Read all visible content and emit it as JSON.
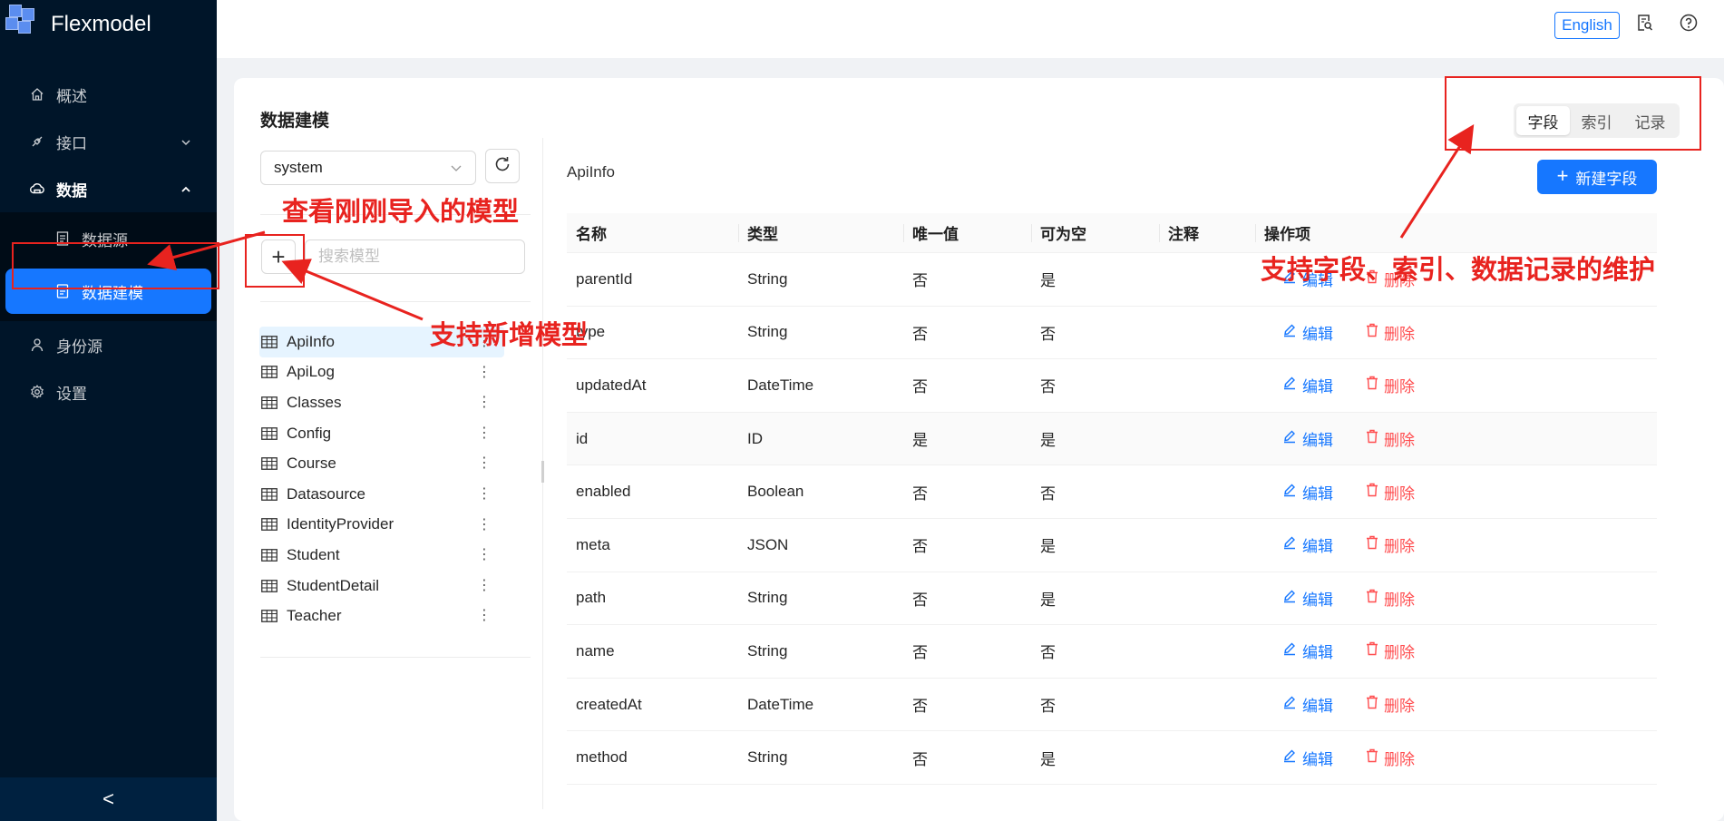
{
  "app": {
    "title": "Flexmodel"
  },
  "sidebar": {
    "items": [
      {
        "label": "概述",
        "icon": "home-icon"
      },
      {
        "label": "接口",
        "icon": "api-icon"
      },
      {
        "label": "数据",
        "icon": "cloud-icon"
      },
      {
        "label": "数据源",
        "icon": "file-icon"
      },
      {
        "label": "数据建模",
        "icon": "doc-icon"
      },
      {
        "label": "身份源",
        "icon": "user-icon"
      },
      {
        "label": "设置",
        "icon": "gear-icon"
      }
    ],
    "collapse": "<"
  },
  "header": {
    "lang": "English"
  },
  "page": {
    "title": "数据建模",
    "datasource": "system",
    "search_placeholder": "搜索模型",
    "models": [
      "ApiInfo",
      "ApiLog",
      "Classes",
      "Config",
      "Course",
      "Datasource",
      "IdentityProvider",
      "Student",
      "StudentDetail",
      "Teacher"
    ],
    "selected_model": "ApiInfo"
  },
  "right": {
    "tabs": [
      "字段",
      "索引",
      "记录"
    ],
    "active_tab": "字段",
    "model_name": "ApiInfo",
    "new_button": "新建字段",
    "columns": [
      "名称",
      "类型",
      "唯一值",
      "可为空",
      "注释",
      "操作项"
    ],
    "rows": [
      {
        "name": "parentId",
        "type": "String",
        "unique": "否",
        "nullable": "是",
        "comment": ""
      },
      {
        "name": "type",
        "type": "String",
        "unique": "否",
        "nullable": "否",
        "comment": ""
      },
      {
        "name": "updatedAt",
        "type": "DateTime",
        "unique": "否",
        "nullable": "否",
        "comment": ""
      },
      {
        "name": "id",
        "type": "ID",
        "unique": "是",
        "nullable": "是",
        "comment": ""
      },
      {
        "name": "enabled",
        "type": "Boolean",
        "unique": "否",
        "nullable": "否",
        "comment": ""
      },
      {
        "name": "meta",
        "type": "JSON",
        "unique": "否",
        "nullable": "是",
        "comment": ""
      },
      {
        "name": "path",
        "type": "String",
        "unique": "否",
        "nullable": "是",
        "comment": ""
      },
      {
        "name": "name",
        "type": "String",
        "unique": "否",
        "nullable": "否",
        "comment": ""
      },
      {
        "name": "createdAt",
        "type": "DateTime",
        "unique": "否",
        "nullable": "否",
        "comment": ""
      },
      {
        "name": "method",
        "type": "String",
        "unique": "否",
        "nullable": "是",
        "comment": ""
      }
    ],
    "edit_label": "编辑",
    "delete_label": "删除"
  },
  "annotations": {
    "view_imported": "查看刚刚导入的模型",
    "add_model": "支持新增模型",
    "tabs_support": "支持字段、索引、数据记录的维护"
  },
  "colors": {
    "sidebar": "#001529",
    "primary": "#1677ff",
    "danger": "#ff4d4f",
    "annotation": "#e8231f"
  }
}
